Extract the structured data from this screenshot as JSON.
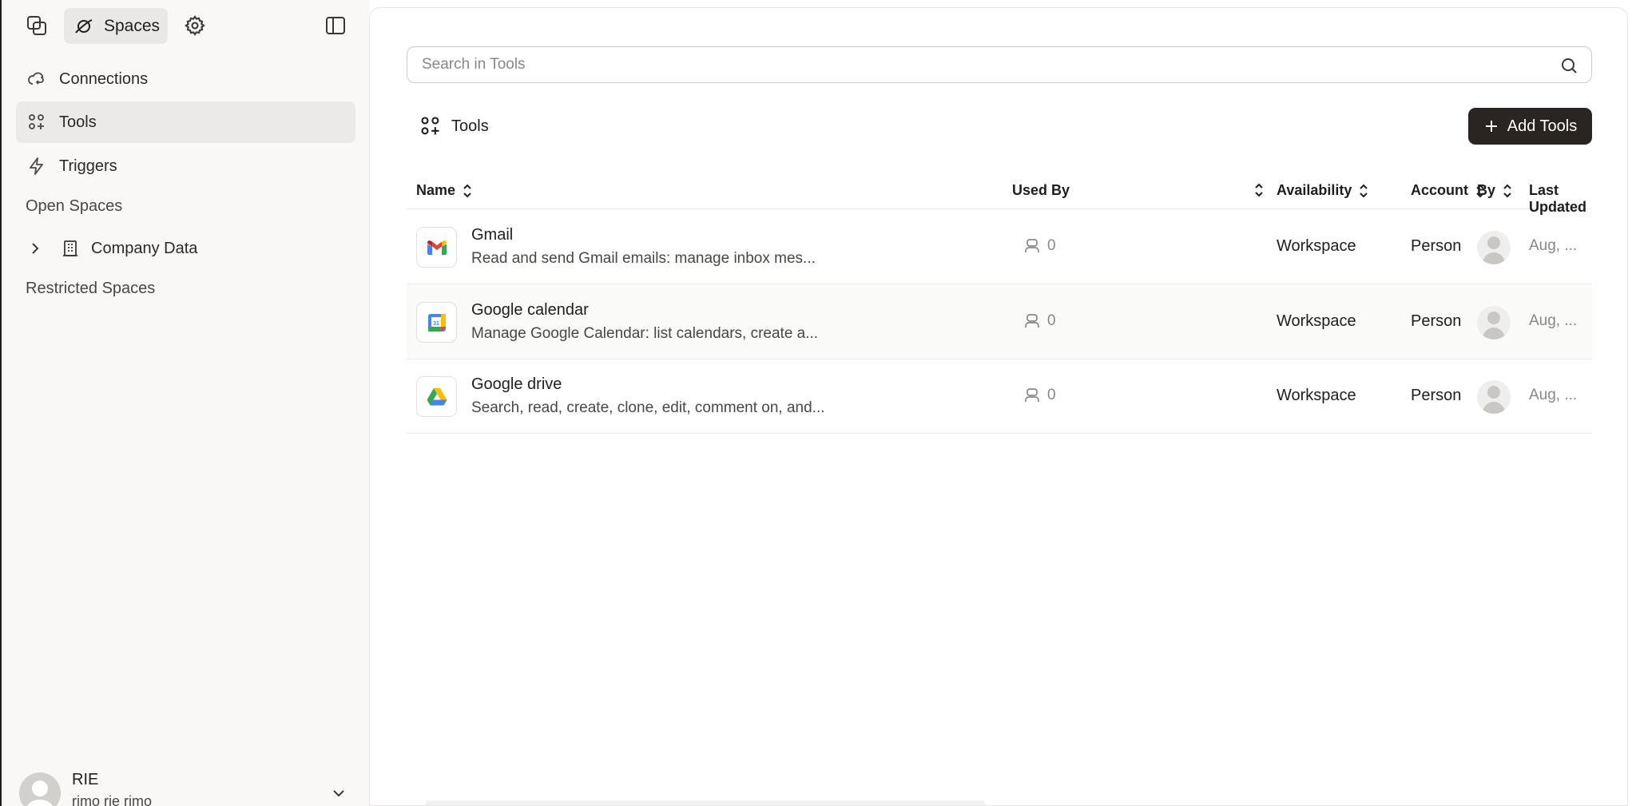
{
  "sidebar": {
    "top": {
      "spaces_label": "Spaces"
    },
    "nav": [
      {
        "label": "Connections",
        "icon": "cloud-sync-icon"
      },
      {
        "label": "Tools",
        "icon": "tools-grid-icon",
        "active": true
      },
      {
        "label": "Triggers",
        "icon": "lightning-icon"
      }
    ],
    "open_spaces_label": "Open Spaces",
    "tree": [
      {
        "label": "Company Data",
        "icon": "building-icon"
      }
    ],
    "restricted_spaces_label": "Restricted Spaces",
    "user": {
      "name": "RIE",
      "subtitle": "rimo rie rimo"
    }
  },
  "main": {
    "search": {
      "placeholder": "Search in Tools",
      "value": ""
    },
    "section_title": "Tools",
    "add_button_label": "Add Tools",
    "columns": {
      "name": "Name",
      "used_by": "Used By",
      "availability": "Availability",
      "account": "Account",
      "by": "By",
      "last_updated": "Last Updated"
    },
    "rows": [
      {
        "name": "Gmail",
        "description": "Read and send Gmail emails: manage inbox mes...",
        "icon": "gmail-icon",
        "used_by": "0",
        "availability": "Workspace",
        "account": "Person",
        "last_updated": "Aug, ..."
      },
      {
        "name": "Google calendar",
        "description": "Manage Google Calendar: list calendars, create a...",
        "icon": "google-calendar-icon",
        "used_by": "0",
        "availability": "Workspace",
        "account": "Person",
        "last_updated": "Aug, ..."
      },
      {
        "name": "Google drive",
        "description": "Search, read, create, clone, edit, comment on, and...",
        "icon": "google-drive-icon",
        "used_by": "0",
        "availability": "Workspace",
        "account": "Person",
        "last_updated": "Aug, ..."
      }
    ]
  },
  "colors": {
    "sidebar_bg": "#f9f8f7",
    "active_nav_bg": "#ebeae8",
    "primary_button": "#2a2522",
    "text_primary": "#1f1e1c",
    "text_muted": "#8a8784"
  }
}
